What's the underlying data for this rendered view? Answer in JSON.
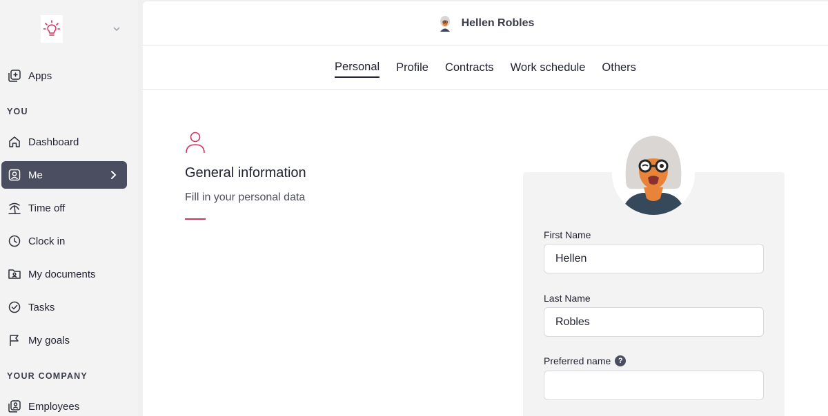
{
  "sidebar": {
    "apps_label": "Apps",
    "section_you": "YOU",
    "items_you": [
      {
        "label": "Dashboard"
      },
      {
        "label": "Me"
      },
      {
        "label": "Time off"
      },
      {
        "label": "Clock in"
      },
      {
        "label": "My documents"
      },
      {
        "label": "Tasks"
      },
      {
        "label": "My goals"
      }
    ],
    "section_company": "YOUR COMPANY",
    "items_company": [
      {
        "label": "Employees"
      }
    ]
  },
  "header": {
    "user_name": "Hellen Robles"
  },
  "tabs": [
    {
      "label": "Personal"
    },
    {
      "label": "Profile"
    },
    {
      "label": "Contracts"
    },
    {
      "label": "Work schedule"
    },
    {
      "label": "Others"
    }
  ],
  "section": {
    "title": "General information",
    "subtitle": "Fill in your personal data"
  },
  "form": {
    "first_name_label": "First Name",
    "first_name_value": "Hellen",
    "last_name_label": "Last Name",
    "last_name_value": "Robles",
    "preferred_name_label": "Preferred name",
    "preferred_name_value": "",
    "help_glyph": "?"
  },
  "colors": {
    "accent": "#d0365e",
    "active_nav": "#4b4d60"
  }
}
